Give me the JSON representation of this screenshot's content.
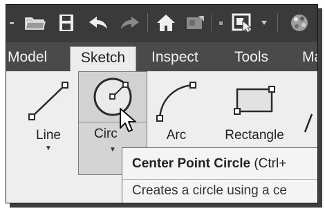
{
  "quick_access_toolbar": {
    "icons": [
      "open-folder-icon",
      "save-icon",
      "undo-icon",
      "redo-icon",
      "home-icon",
      "update-icon",
      "select-icon",
      "appearance-icon"
    ]
  },
  "ribbon_tabs": [
    "Model",
    "Sketch",
    "Inspect",
    "Tools",
    "Ma"
  ],
  "active_tab": "Sketch",
  "tools": {
    "line": {
      "label": "Line"
    },
    "circle": {
      "label": "Circ"
    },
    "arc": {
      "label": "Arc"
    },
    "rectangle": {
      "label": "Rectangle"
    }
  },
  "tooltip": {
    "title": "Center Point Circle",
    "shortcut": " (Ctrl+",
    "description": "Creates a circle using a ce"
  }
}
